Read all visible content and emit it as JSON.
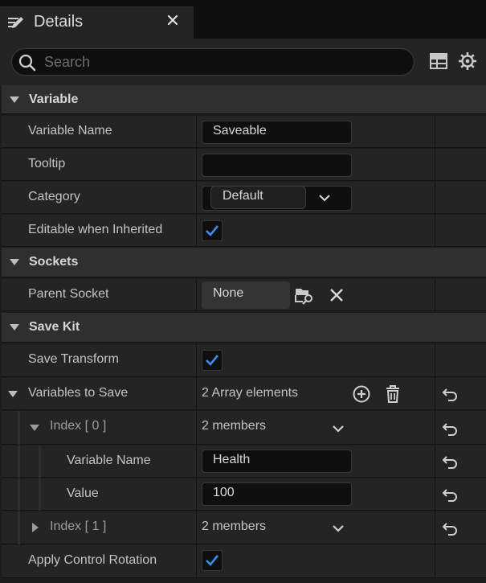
{
  "tab": {
    "title": "Details",
    "icon": "pencil-icon"
  },
  "search": {
    "placeholder": "Search",
    "value": ""
  },
  "toolbar": {
    "table_icon": "table-view-icon",
    "settings_icon": "gear-icon"
  },
  "sections": {
    "variable": {
      "title": "Variable",
      "rows": {
        "variable_name": {
          "label": "Variable Name",
          "value": "Saveable"
        },
        "tooltip": {
          "label": "Tooltip",
          "value": ""
        },
        "category": {
          "label": "Category",
          "value": "Default"
        },
        "editable": {
          "label": "Editable when Inherited",
          "checked": true
        }
      }
    },
    "sockets": {
      "title": "Sockets",
      "rows": {
        "parent_socket": {
          "label": "Parent Socket",
          "value": "None"
        }
      }
    },
    "save_kit": {
      "title": "Save Kit",
      "rows": {
        "save_transform": {
          "label": "Save Transform",
          "checked": true
        },
        "variables_to_save": {
          "label": "Variables to Save",
          "value": "2 Array elements"
        },
        "index0": {
          "label": "Index [ 0 ]",
          "value": "2 members"
        },
        "index0_variable_name": {
          "label": "Variable Name",
          "value": "Health"
        },
        "index0_value": {
          "label": "Value",
          "value": "100"
        },
        "index1": {
          "label": "Index [ 1 ]",
          "value": "2 members"
        },
        "apply_control_rotation": {
          "label": "Apply Control Rotation",
          "checked": true
        }
      }
    }
  },
  "colors": {
    "accent": "#3a8ef0",
    "panel": "#242424",
    "header": "#2f2f2f",
    "field": "#0f0f0f"
  }
}
